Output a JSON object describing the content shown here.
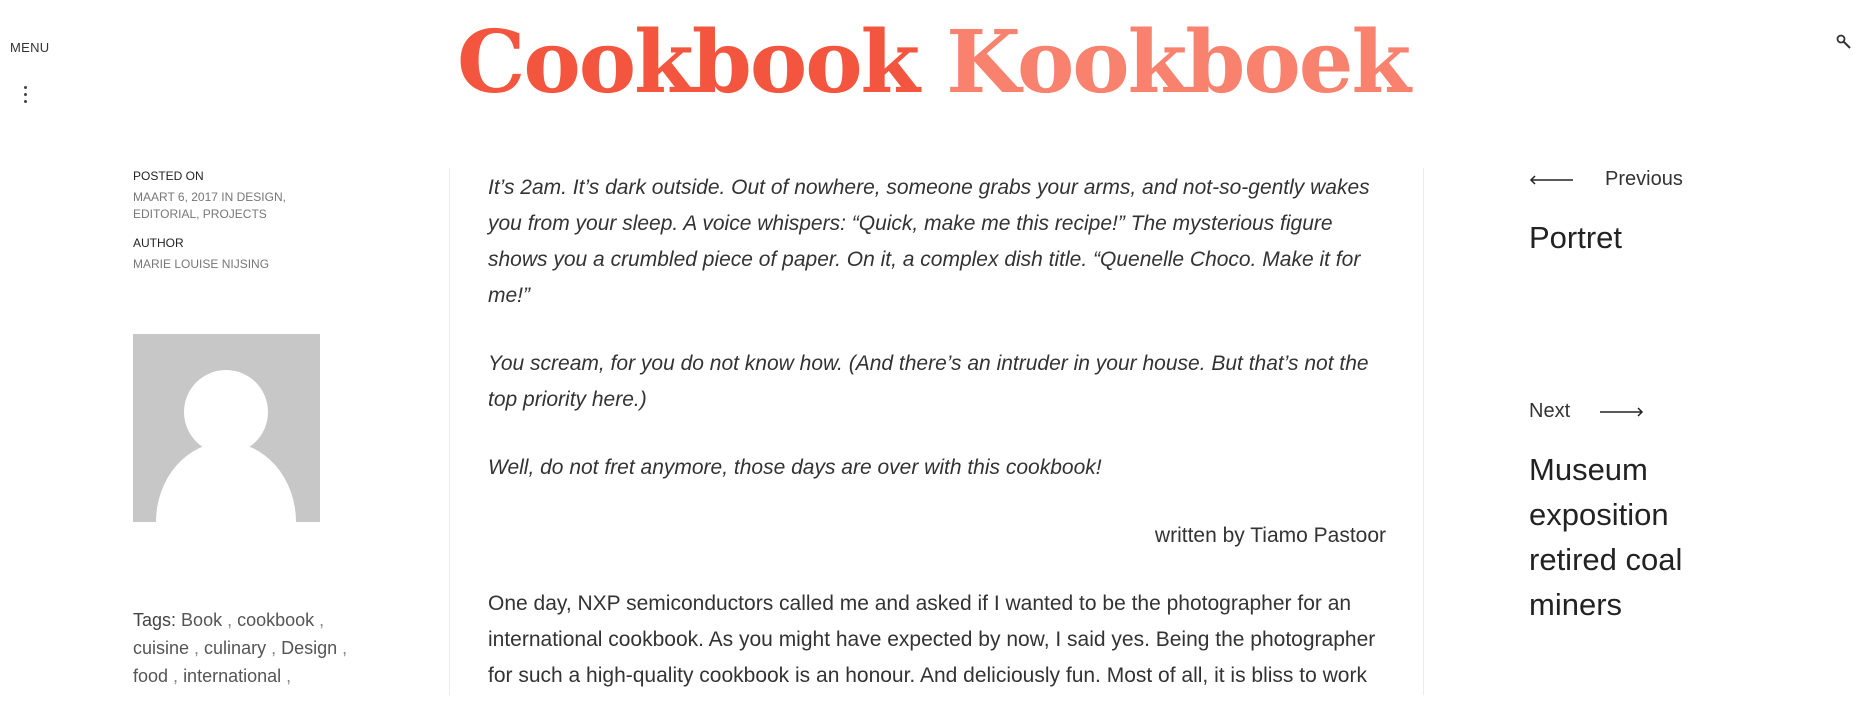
{
  "header": {
    "menu_label": "MENU",
    "title_part1": "Cookbook",
    "title_part2": "Kookboek",
    "accent_color": "#f4553e",
    "accent_color_light": "#f8826d"
  },
  "meta": {
    "posted_on_label": "POSTED ON",
    "posted_on_value": "MAART 6, 2017 IN DESIGN, EDITORIAL, PROJECTS",
    "author_label": "AUTHOR",
    "author_value": "MARIE LOUISE NIJSING",
    "tags_label": "Tags:",
    "tags": [
      "Book",
      "cookbook",
      "cuisine",
      "culinary",
      "Design",
      "food",
      "international"
    ]
  },
  "content": {
    "intro_p1": "It’s 2am. It’s dark outside. Out of nowhere, someone grabs your arms, and not-so-gently wakes you from your sleep. A voice whispers: “Quick, make me this recipe!” The mysterious figure shows you a crumbled piece of paper. On it, a complex dish title. “Quenelle Choco. Make it for me!”",
    "intro_p2": "You scream, for you do not know how. (And there’s an intruder in your house. But that’s not the top priority here.)",
    "intro_p3": "Well, do not fret anymore, those days are over with this cookbook!",
    "byline": "written by Tiamo Pastoor",
    "body_p1": "One day, NXP semiconductors called me and asked if I wanted to be the photographer for an international cookbook. As you might have expected by now, I said yes. Being the photographer for such a high-quality cookbook is an honour. And deliciously fun. Most of all, it is bliss to work"
  },
  "nav": {
    "previous_label": "Previous",
    "previous_title": "Portret",
    "next_label": "Next",
    "next_title": "Museum exposition retired coal miners"
  },
  "icons": [
    "search-icon",
    "kebab-menu-icon",
    "arrow-left-icon",
    "arrow-right-icon",
    "avatar-placeholder-icon"
  ]
}
